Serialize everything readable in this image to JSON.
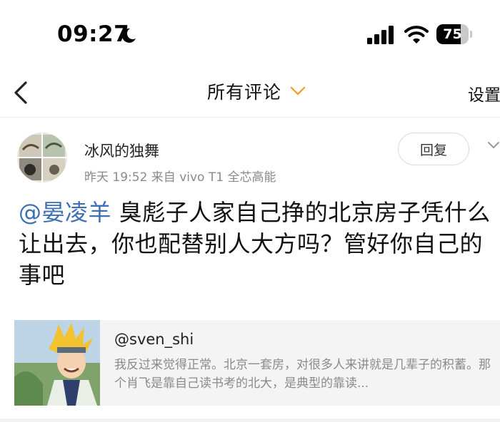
{
  "status_bar": {
    "time": "09:27",
    "battery": "75",
    "battery_level": 0.75
  },
  "nav": {
    "title": "所有评论",
    "settings_label": "设置"
  },
  "comment": {
    "username": "冰风的独舞",
    "meta": "昨天 19:52  来自 vivo T1 全芯高能",
    "reply_label": "回复",
    "mention": "@晏凌羊",
    "body": " 臭彪子人家自己挣的北京房子凭什么让出去，你也配替别人大方吗？管好你自己的事吧"
  },
  "quote": {
    "username": "@sven_shi",
    "text": "我反过来觉得正常。北京一套房，对很多人来讲就是几辈子的积蓄。那个肖飞是靠自己读书考的北大，是典型的靠读..."
  },
  "colors": {
    "accent_chevron": "#f0a33a",
    "mention": "#3c6fb4",
    "muted_text": "#8a8a8a",
    "card_bg": "#f4f4f4"
  },
  "icons": [
    "moon-icon",
    "signal-icon",
    "wifi-icon",
    "battery-icon",
    "back-icon",
    "chevron-down-icon"
  ]
}
